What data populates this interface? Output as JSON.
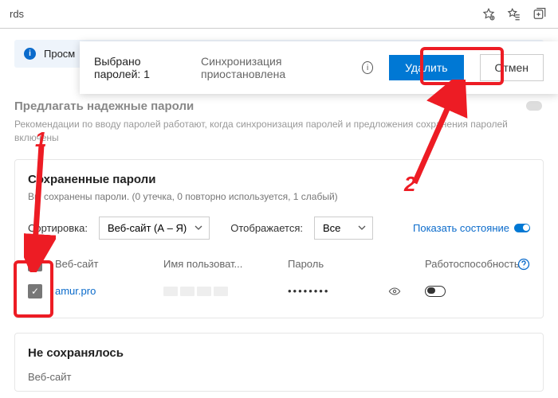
{
  "address_url": "rds",
  "infobar": {
    "text": "Просм"
  },
  "popover": {
    "selected": "Выбрано паролей: 1",
    "sync": "Синхронизация приостановлена",
    "delete": "Удалить",
    "cancel": "Отмен"
  },
  "suggest": {
    "title": "Предлагать надежные пароли",
    "sub": "Рекомендации по вводу паролей работают, когда синхронизация паролей и предложения сохранения паролей включены"
  },
  "saved": {
    "title": "Сохраненные пароли",
    "sub": "Вы сохранены пароли. (0 утечка, 0 повторно используется, 1 слабый)",
    "sort_label": "Сортировка:",
    "sort_value": "Веб-сайт (А – Я)",
    "display_label": "Отображается:",
    "display_value": "Все",
    "show_state": "Показать состояние",
    "cols": {
      "site": "Веб-сайт",
      "user": "Имя пользоват...",
      "pass": "Пароль",
      "health": "Работоспособность"
    },
    "rows": [
      {
        "site": "amur.pro",
        "password_mask": "••••••••"
      }
    ]
  },
  "never": {
    "title": "Не сохранялось",
    "col_site": "Веб-сайт"
  },
  "annotations": {
    "n1": "1",
    "n2": "2"
  }
}
